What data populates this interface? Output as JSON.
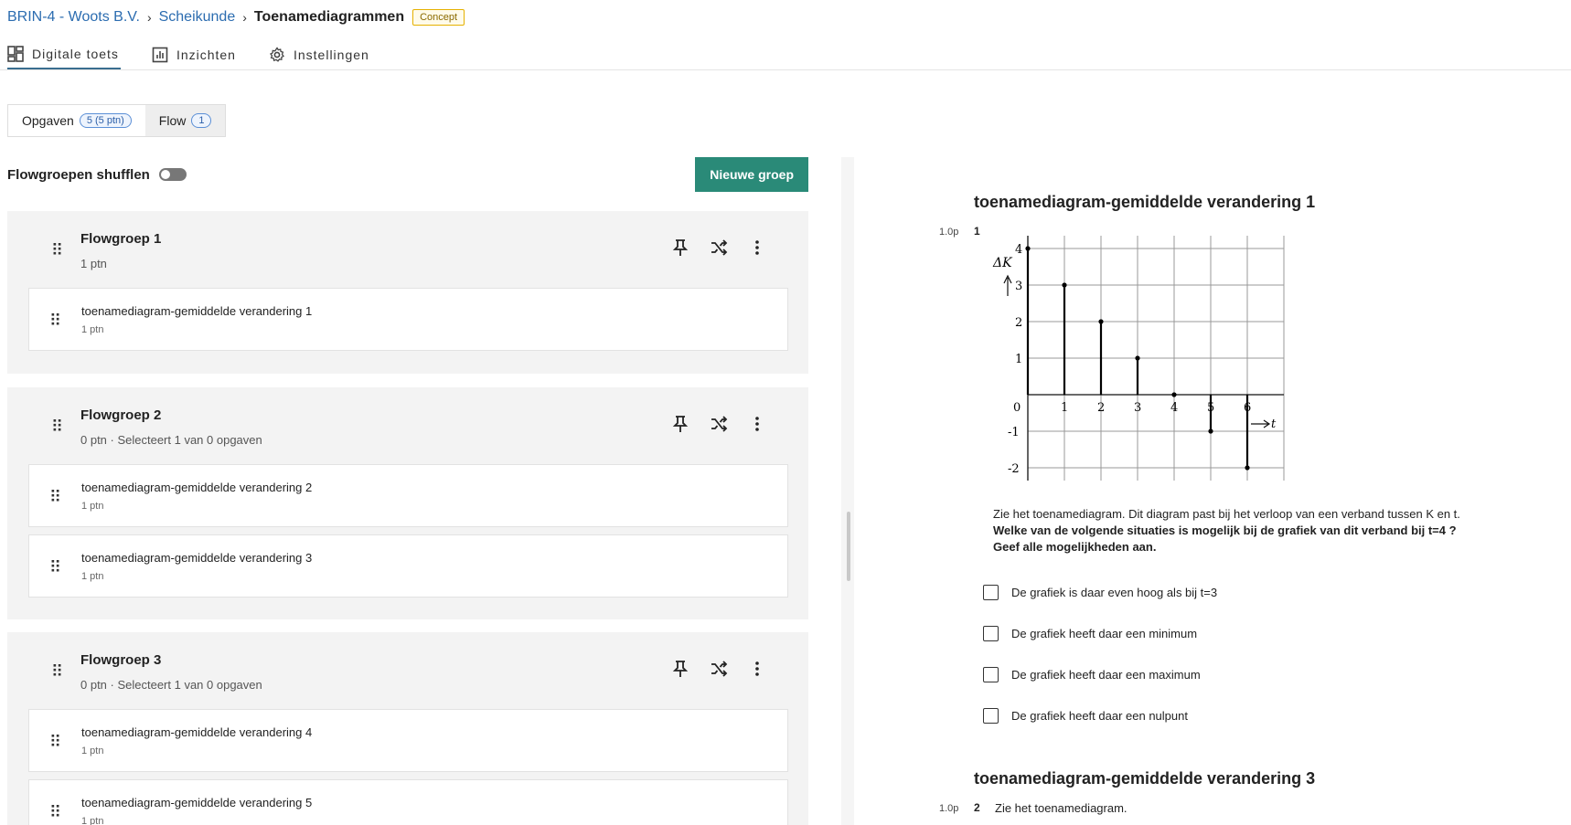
{
  "breadcrumb": {
    "org": "BRIN-4 - Woots B.V.",
    "course": "Scheikunde",
    "current": "Toenamediagrammen",
    "status": "Concept"
  },
  "nav": [
    {
      "label": "Digitale toets",
      "icon": "dashboard-icon"
    },
    {
      "label": "Inzichten",
      "icon": "chart-icon"
    },
    {
      "label": "Instellingen",
      "icon": "gear-icon"
    }
  ],
  "subtabs": [
    {
      "label": "Opgaven",
      "badge": "5 (5 ptn)"
    },
    {
      "label": "Flow",
      "badge": "1"
    }
  ],
  "shuffle": {
    "label": "Flowgroepen shufflen",
    "new_group": "Nieuwe groep"
  },
  "groups": [
    {
      "title": "Flowgroep 1",
      "subtitle": "1 ptn",
      "items": [
        {
          "title": "toenamediagram-gemiddelde verandering 1",
          "points": "1 ptn"
        }
      ]
    },
    {
      "title": "Flowgroep 2",
      "subtitle": "0 ptn · Selecteert 1 van 0 opgaven",
      "items": [
        {
          "title": "toenamediagram-gemiddelde verandering 2",
          "points": "1 ptn"
        },
        {
          "title": "toenamediagram-gemiddelde verandering 3",
          "points": "1 ptn"
        }
      ]
    },
    {
      "title": "Flowgroep 3",
      "subtitle": "0 ptn · Selecteert 1 van 0 opgaven",
      "items": [
        {
          "title": "toenamediagram-gemiddelde verandering 4",
          "points": "1 ptn"
        },
        {
          "title": "toenamediagram-gemiddelde verandering 5",
          "points": "1 ptn"
        }
      ]
    }
  ],
  "preview": {
    "q1": {
      "title": "toenamediagram-gemiddelde verandering 1",
      "points": "1.0p",
      "number": "1",
      "intro": "Zie het toenamediagram. Dit diagram past bij het verloop van een verband tussen K en t.",
      "question_line1": "Welke van de volgende situaties is mogelijk bij de grafiek van dit verband bij t=4 ?",
      "question_line2": "Geef alle mogelijkheden aan.",
      "options": [
        "De grafiek is daar even hoog als bij t=3",
        "De grafiek heeft daar een minimum",
        "De grafiek heeft daar een maximum",
        "De grafiek heeft daar een nulpunt"
      ]
    },
    "q2": {
      "title": "toenamediagram-gemiddelde verandering 3",
      "points": "1.0p",
      "number": "2",
      "intro": "Zie het toenamediagram."
    }
  },
  "chart_data": {
    "type": "bar",
    "x": [
      0,
      1,
      2,
      3,
      4,
      5,
      6
    ],
    "values": [
      4,
      3,
      2,
      1,
      0,
      -1,
      -2
    ],
    "xlabel": "t",
    "ylabel": "ΔK",
    "x_ticks": [
      "0",
      "1",
      "2",
      "3",
      "4",
      "5",
      "6"
    ],
    "y_ticks": [
      "4",
      "3",
      "2",
      "1",
      "-1",
      "-2"
    ],
    "xlim": [
      0,
      7
    ],
    "ylim": [
      -2,
      4
    ],
    "grid": true
  }
}
